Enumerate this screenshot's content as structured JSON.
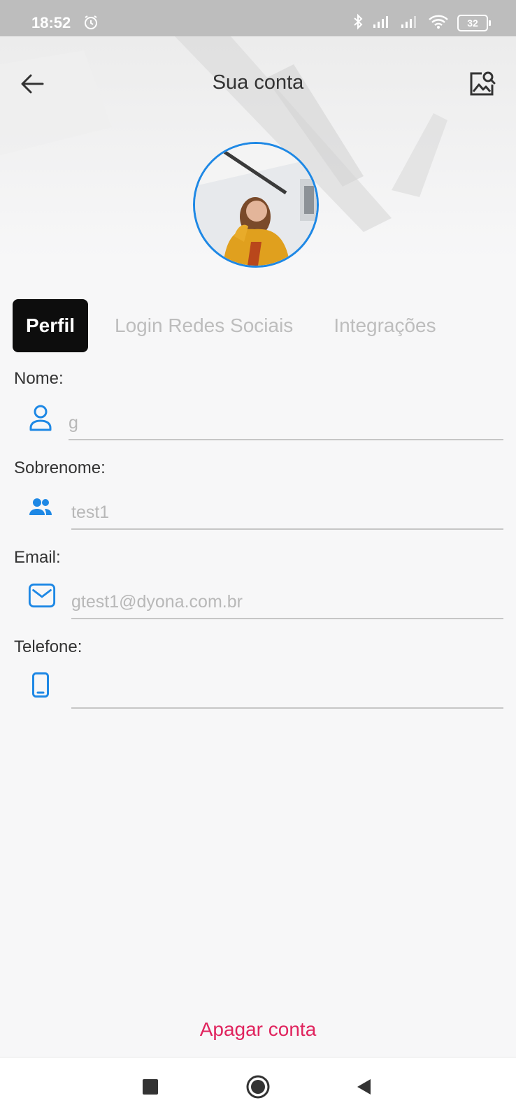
{
  "status_bar": {
    "time": "18:52",
    "battery": "32",
    "icons": [
      "alarm-icon",
      "bluetooth-icon",
      "signal-icon",
      "signal-icon",
      "wifi-icon",
      "battery-icon"
    ]
  },
  "header": {
    "title": "Sua conta",
    "back_icon": "arrow-left-icon",
    "action_icon": "image-search-icon"
  },
  "profile": {
    "avatar_border_color": "#1e88e5"
  },
  "tabs": [
    {
      "label": "Perfil",
      "active": true
    },
    {
      "label": "Login Redes Sociais",
      "active": false
    },
    {
      "label": "Integrações",
      "active": false
    }
  ],
  "form": {
    "nome": {
      "label": "Nome:",
      "value": "g",
      "icon": "person-icon"
    },
    "sobrenome": {
      "label": "Sobrenome:",
      "value": "test1",
      "icon": "people-icon"
    },
    "email": {
      "label": "Email:",
      "value": "gtest1@dyona.com.br",
      "icon": "mail-icon"
    },
    "telefone": {
      "label": "Telefone:",
      "value": "",
      "icon": "phone-icon"
    }
  },
  "footer": {
    "delete_label": "Apagar conta"
  },
  "colors": {
    "accent": "#1e88e5",
    "danger": "#e0245e",
    "active_tab_bg": "#0d0d0d"
  }
}
